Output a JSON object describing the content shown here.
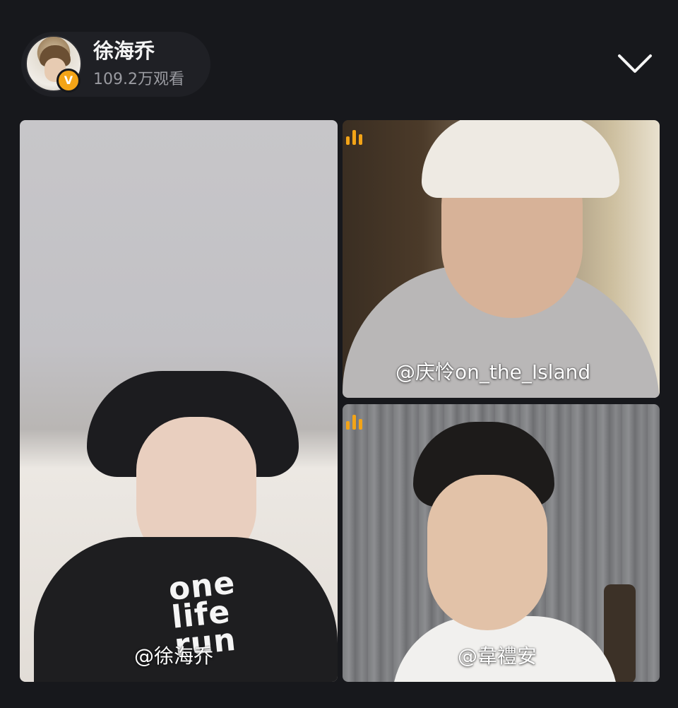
{
  "header": {
    "host_name": "徐海乔",
    "viewer_count": "109.2万观看",
    "verified_badge_letter": "V",
    "collapse_icon": "chevron-down-icon"
  },
  "tiles": [
    {
      "label": "@徐海乔",
      "shirt_print": "one\nlife\nrun",
      "audio_indicator": false
    },
    {
      "label": "@庆怜on_the_Island",
      "audio_indicator": true
    },
    {
      "label": "@韋禮安",
      "audio_indicator": true
    }
  ],
  "colors": {
    "background": "#17181c",
    "accent_audio": "#f3a417",
    "badge": "#f3a417",
    "text_primary": "#f3f3f3",
    "text_secondary": "#9a9ba1"
  }
}
